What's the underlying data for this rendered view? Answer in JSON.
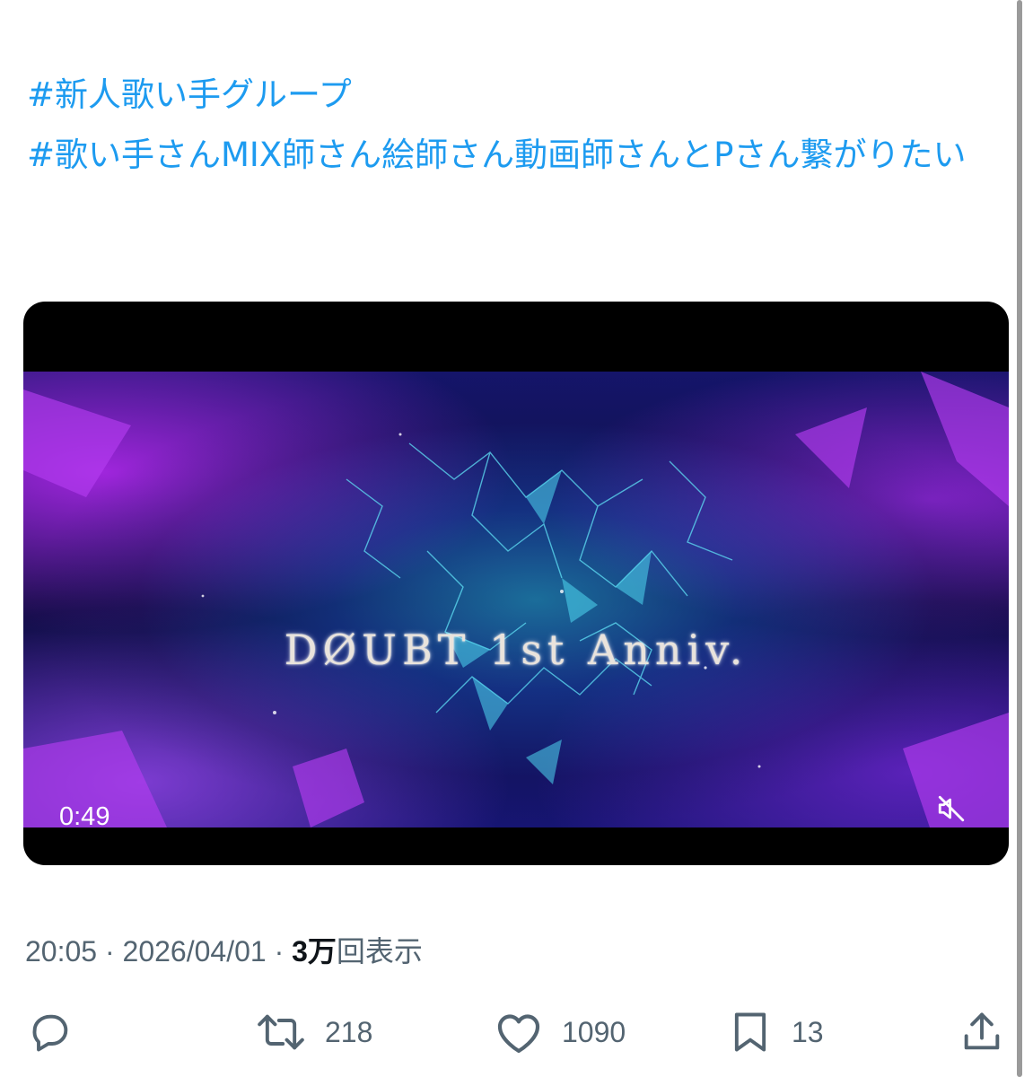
{
  "tweet": {
    "hashtags": [
      "#新人歌い手グループ",
      "#歌い手さんMIX師さん絵師さん動画師さんとPさん繋がりたい"
    ]
  },
  "video": {
    "overlay_title": "DØUBT 1st Anniv.",
    "duration": "0:49"
  },
  "meta": {
    "time": "20:05",
    "separator": " · ",
    "date": "2026/04/01",
    "views_count": "3万",
    "views_label": "回表示"
  },
  "actions": {
    "retweets": "218",
    "likes": "1090",
    "bookmarks": "13"
  },
  "colors": {
    "link": "#1d9bf0",
    "muted": "#536471",
    "text": "#0f1419"
  }
}
